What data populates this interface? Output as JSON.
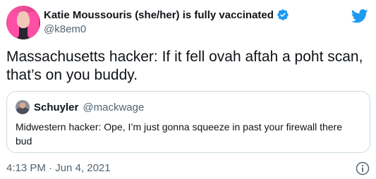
{
  "author": {
    "display_name": "Katie Moussouris (she/her) is fully vaccinated",
    "handle": "@k8em0",
    "verified": true
  },
  "tweet": {
    "text": "Massachusetts hacker: If it fell ovah aftah a poht scan, that’s on you buddy.",
    "timestamp": "4:13 PM",
    "separator": "·",
    "date": "Jun 4, 2021"
  },
  "quoted_tweet": {
    "display_name": "Schuyler",
    "handle": "@mackwage",
    "text": "Midwestern hacker: Ope, I’m just gonna squeeze in past your firewall there bud"
  },
  "icons": {
    "verified": "verified-badge-icon",
    "brand": "twitter-bird-icon",
    "info": "info-icon"
  },
  "colors": {
    "brand_blue": "#1d9bf0",
    "secondary_text": "#536471",
    "border": "#cfd9de"
  }
}
